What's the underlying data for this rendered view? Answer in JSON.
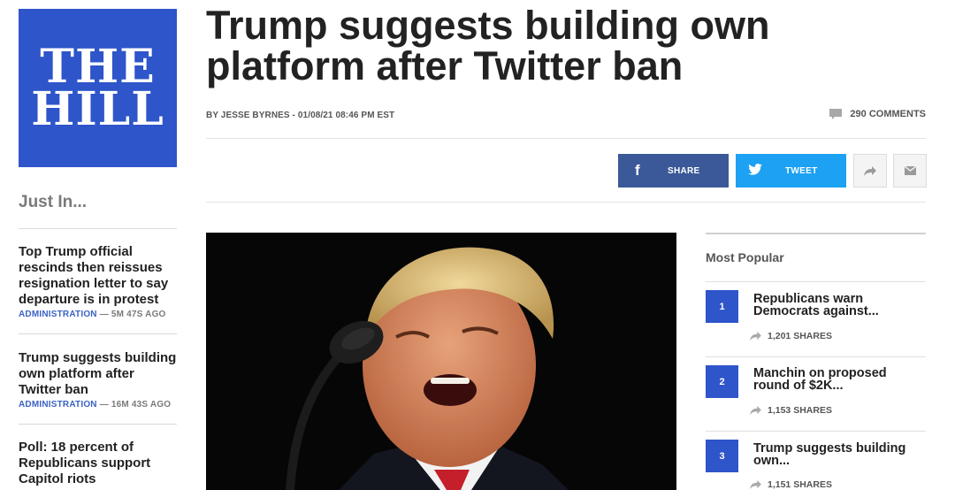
{
  "logo": {
    "line1": "THE",
    "line2": "HILL"
  },
  "sidebar": {
    "heading": "Just In...",
    "items": [
      {
        "title": "Top Trump official rescinds then reissues resignation letter to say departure is in protest",
        "category": "ADMINISTRATION",
        "age": " — 5M 47S AGO"
      },
      {
        "title": "Trump suggests building own platform after Twitter ban",
        "category": "ADMINISTRATION",
        "age": " — 16M 43S AGO"
      },
      {
        "title": "Poll: 18 percent of Republicans support Capitol riots",
        "category": "",
        "age": ""
      }
    ]
  },
  "article": {
    "headline": "Trump suggests building own platform after Twitter ban",
    "byline": "BY JESSE BYRNES - 01/08/21 08:46 PM EST",
    "comments": "290 COMMENTS"
  },
  "share": {
    "facebook_label": "SHARE",
    "twitter_label": "TWEET"
  },
  "icons": {
    "facebook": "facebook-icon",
    "twitter": "twitter-icon",
    "share": "share-arrow-icon",
    "email": "email-icon",
    "comment": "comment-icon"
  },
  "colors": {
    "brand": "#2e55c9",
    "facebook": "#3b5998",
    "twitter": "#1da1f2",
    "category": "#3b63c4"
  },
  "most_popular": {
    "title": "Most Popular",
    "items": [
      {
        "rank": "1",
        "title": "Republicans warn Democrats against...",
        "shares": "1,201 SHARES"
      },
      {
        "rank": "2",
        "title": "Manchin on proposed round of $2K...",
        "shares": "1,153 SHARES"
      },
      {
        "rank": "3",
        "title": "Trump suggests building own...",
        "shares": "1,151 SHARES"
      }
    ]
  }
}
